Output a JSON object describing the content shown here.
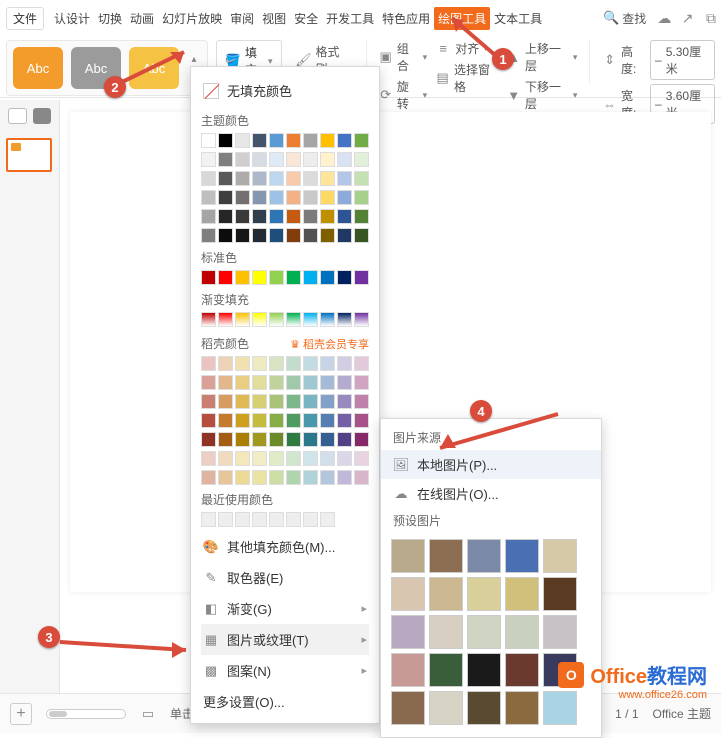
{
  "tabs": {
    "file": "文件",
    "items": [
      "认设计",
      "切换",
      "动画",
      "幻灯片放映",
      "审阅",
      "视图",
      "安全",
      "开发工具",
      "特色应用",
      "绘图工具",
      "文本工具"
    ],
    "active_index": 9,
    "search": "查找"
  },
  "shape_gallery": {
    "labels": [
      "Abc",
      "Abc",
      "Abc"
    ]
  },
  "toolbar": {
    "fill": "填充",
    "format_painter": "格式刷",
    "group": "组合",
    "rotate": "旋转",
    "align": "对齐",
    "select_pane": "选择窗格",
    "move_up": "上移一层",
    "move_down": "下移一层",
    "height_label": "高度:",
    "width_label": "宽度:",
    "height_val": "5.30厘米",
    "width_val": "3.60厘米"
  },
  "fill_panel": {
    "no_fill": "无填充颜色",
    "theme": "主题颜色",
    "standard": "标准色",
    "gradient": "渐变填充",
    "doke": "稻壳颜色",
    "doke_vip": "稻壳会员专享",
    "recent": "最近使用颜色",
    "more_colors": "其他填充颜色(M)...",
    "eyedropper": "取色器(E)",
    "gradient_item": "渐变(G)",
    "picture_texture": "图片或纹理(T)",
    "pattern": "图案(N)",
    "more_settings": "更多设置(O)...",
    "theme_row1": [
      "#ffffff",
      "#000000",
      "#e7e6e6",
      "#44546a",
      "#5b9bd5",
      "#ed7d31",
      "#a5a5a5",
      "#ffc000",
      "#4472c4",
      "#70ad47"
    ],
    "theme_shades": [
      [
        "#f2f2f2",
        "#7f7f7f",
        "#d0cece",
        "#d6dce4",
        "#deebf6",
        "#fbe5d5",
        "#ededed",
        "#fff2cc",
        "#d9e2f3",
        "#e2efd9"
      ],
      [
        "#d8d8d8",
        "#595959",
        "#aeabab",
        "#adb9ca",
        "#bdd7ee",
        "#f7cbac",
        "#dbdbdb",
        "#fee599",
        "#b4c6e7",
        "#c5e0b3"
      ],
      [
        "#bfbfbf",
        "#3f3f3f",
        "#757070",
        "#8496b0",
        "#9cc3e5",
        "#f4b183",
        "#c9c9c9",
        "#ffd965",
        "#8eaadb",
        "#a8d08d"
      ],
      [
        "#a5a5a5",
        "#262626",
        "#3a3838",
        "#323f4f",
        "#2e75b5",
        "#c55a11",
        "#7b7b7b",
        "#bf9000",
        "#2f5496",
        "#538135"
      ],
      [
        "#7f7f7f",
        "#0c0c0c",
        "#171616",
        "#222a35",
        "#1e4e79",
        "#833c0b",
        "#525252",
        "#7f6000",
        "#1f3864",
        "#375623"
      ]
    ],
    "standard_colors": [
      "#c00000",
      "#ff0000",
      "#ffc000",
      "#ffff00",
      "#92d050",
      "#00b050",
      "#00b0f0",
      "#0070c0",
      "#002060",
      "#7030a0"
    ],
    "gradient_colors": [
      "#c00000",
      "#ff0000",
      "#ffc000",
      "#ffff00",
      "#92d050",
      "#00b050",
      "#00b0f0",
      "#0070c0",
      "#002060",
      "#7030a0"
    ],
    "doke_colors": [
      [
        "#e9c4c0",
        "#edd2b7",
        "#f1e0b0",
        "#eceac1",
        "#d7e3c1",
        "#c4dccb",
        "#c3dce3",
        "#c6d4e6",
        "#d2cde3",
        "#e3cadb"
      ],
      [
        "#daa199",
        "#e2b78b",
        "#e8cd82",
        "#e1dd9a",
        "#c0d39c",
        "#a0c9ab",
        "#9ec8d3",
        "#a4bad7",
        "#b5abd1",
        "#d1a5c2"
      ],
      [
        "#cb7e72",
        "#d79c5f",
        "#dfba54",
        "#d6d073",
        "#a9c377",
        "#7cb68b",
        "#79b4c3",
        "#82a0c8",
        "#9889bf",
        "#bf80a9"
      ],
      [
        "#b44f40",
        "#c67a2e",
        "#cfa01f",
        "#c4bc3f",
        "#88ac46",
        "#4f9c63",
        "#4a98ab",
        "#577eb3",
        "#7360a6",
        "#a75289"
      ],
      [
        "#8e3325",
        "#a35d15",
        "#ab7f06",
        "#a1991e",
        "#6a8b28",
        "#2f7c43",
        "#2a788b",
        "#375e93",
        "#534086",
        "#872869"
      ],
      [
        "#eccfc4",
        "#f0dbbf",
        "#f3e7bb",
        "#f1edc6",
        "#e1ebc7",
        "#d1e6cf",
        "#d0e5e9",
        "#d2deea",
        "#dbd6e8",
        "#e8d3e1"
      ],
      [
        "#e0b4a1",
        "#e7c79a",
        "#ecd994",
        "#ebe3a3",
        "#ccdea3",
        "#b0d5ae",
        "#aed4d9",
        "#b3c6dc",
        "#c2b8d9",
        "#d9b5cc"
      ]
    ]
  },
  "submenu": {
    "source": "图片来源",
    "local": "本地图片(P)...",
    "online": "在线图片(O)...",
    "preset": "预设图片",
    "textures": [
      "#b8a98a",
      "#8b6d52",
      "#7b8aa8",
      "#4a6fb3",
      "#d6c9a8",
      "#d9c6b0",
      "#cbb890",
      "#d9cf9a",
      "#d1c07c",
      "#5a3b22",
      "#b7a7c0",
      "#d6cfc2",
      "#d0d4c2",
      "#c9d0c0",
      "#c7c1c6",
      "#c89a96",
      "#3a5e3a",
      "#1a1a1a",
      "#6b3a2f",
      "#3a3a5e",
      "#8a6a4e",
      "#d6d2c4",
      "#5a4a32",
      "#8a6a3e",
      "#a8d4e6"
    ]
  },
  "bottom": {
    "note": "单击此处",
    "page": "1 / 1",
    "theme": "Office 主题"
  },
  "badges": [
    "1",
    "2",
    "3",
    "4"
  ],
  "watermark": {
    "brand_a": "Office",
    "brand_b": "教程网",
    "url": "www.office26.com"
  }
}
